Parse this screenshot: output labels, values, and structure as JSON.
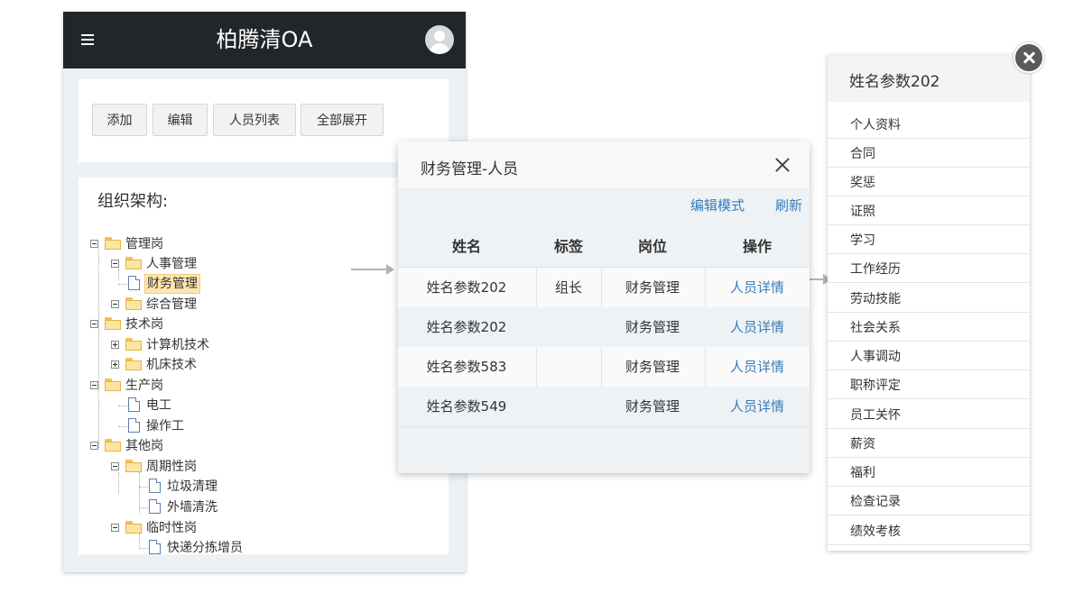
{
  "app": {
    "title": "柏腾清OA"
  },
  "toolbar": {
    "add_label": "添加",
    "edit_label": "编辑",
    "list_label": "人员列表",
    "expand_label": "全部展开"
  },
  "tree": {
    "title": "组织架构:",
    "nodes": [
      {
        "label": "管理岗",
        "kind": "folder",
        "toggle": "minus"
      },
      {
        "label": "人事管理",
        "kind": "folder",
        "toggle": "minus"
      },
      {
        "label": "财务管理",
        "kind": "doc",
        "selected": true
      },
      {
        "label": "综合管理",
        "kind": "folder",
        "toggle": "minus"
      },
      {
        "label": "技术岗",
        "kind": "folder",
        "toggle": "minus"
      },
      {
        "label": "计算机技术",
        "kind": "folder",
        "toggle": "plus"
      },
      {
        "label": "机床技术",
        "kind": "folder",
        "toggle": "plus"
      },
      {
        "label": "生产岗",
        "kind": "folder",
        "toggle": "minus"
      },
      {
        "label": "电工",
        "kind": "doc"
      },
      {
        "label": "操作工",
        "kind": "doc"
      },
      {
        "label": "其他岗",
        "kind": "folder",
        "toggle": "minus"
      },
      {
        "label": "周期性岗",
        "kind": "folder",
        "toggle": "minus"
      },
      {
        "label": "垃圾清理",
        "kind": "doc"
      },
      {
        "label": "外墙清洗",
        "kind": "doc"
      },
      {
        "label": "临时性岗",
        "kind": "folder",
        "toggle": "minus"
      },
      {
        "label": "快递分拣增员",
        "kind": "doc"
      }
    ]
  },
  "dialog": {
    "title": "财务管理-人员",
    "edit_mode_label": "编辑模式",
    "refresh_label": "刷新",
    "columns": [
      "姓名",
      "标签",
      "岗位",
      "操作"
    ],
    "rows": [
      {
        "name": "姓名参数202",
        "tag": "组长",
        "post": "财务管理",
        "action": "人员详情"
      },
      {
        "name": "姓名参数202",
        "tag": "",
        "post": "财务管理",
        "action": "人员详情"
      },
      {
        "name": "姓名参数583",
        "tag": "",
        "post": "财务管理",
        "action": "人员详情"
      },
      {
        "name": "姓名参数549",
        "tag": "",
        "post": "财务管理",
        "action": "人员详情"
      }
    ]
  },
  "person_panel": {
    "title": "姓名参数202",
    "items": [
      "个人资料",
      "合同",
      "奖惩",
      "证照",
      "学习",
      "工作经历",
      "劳动技能",
      "社会关系",
      "人事调动",
      "职称评定",
      "员工关怀",
      "薪资",
      "福利",
      "检查记录",
      "绩效考核"
    ]
  },
  "icons": {
    "menu": "hamburger-icon",
    "avatar": "user-avatar-icon",
    "close": "close-icon",
    "folder": "folder-icon",
    "document": "document-icon"
  },
  "colors": {
    "header_bg": "#222629",
    "link": "#3a7cb8",
    "selected_bg": "#ffe6b0"
  }
}
